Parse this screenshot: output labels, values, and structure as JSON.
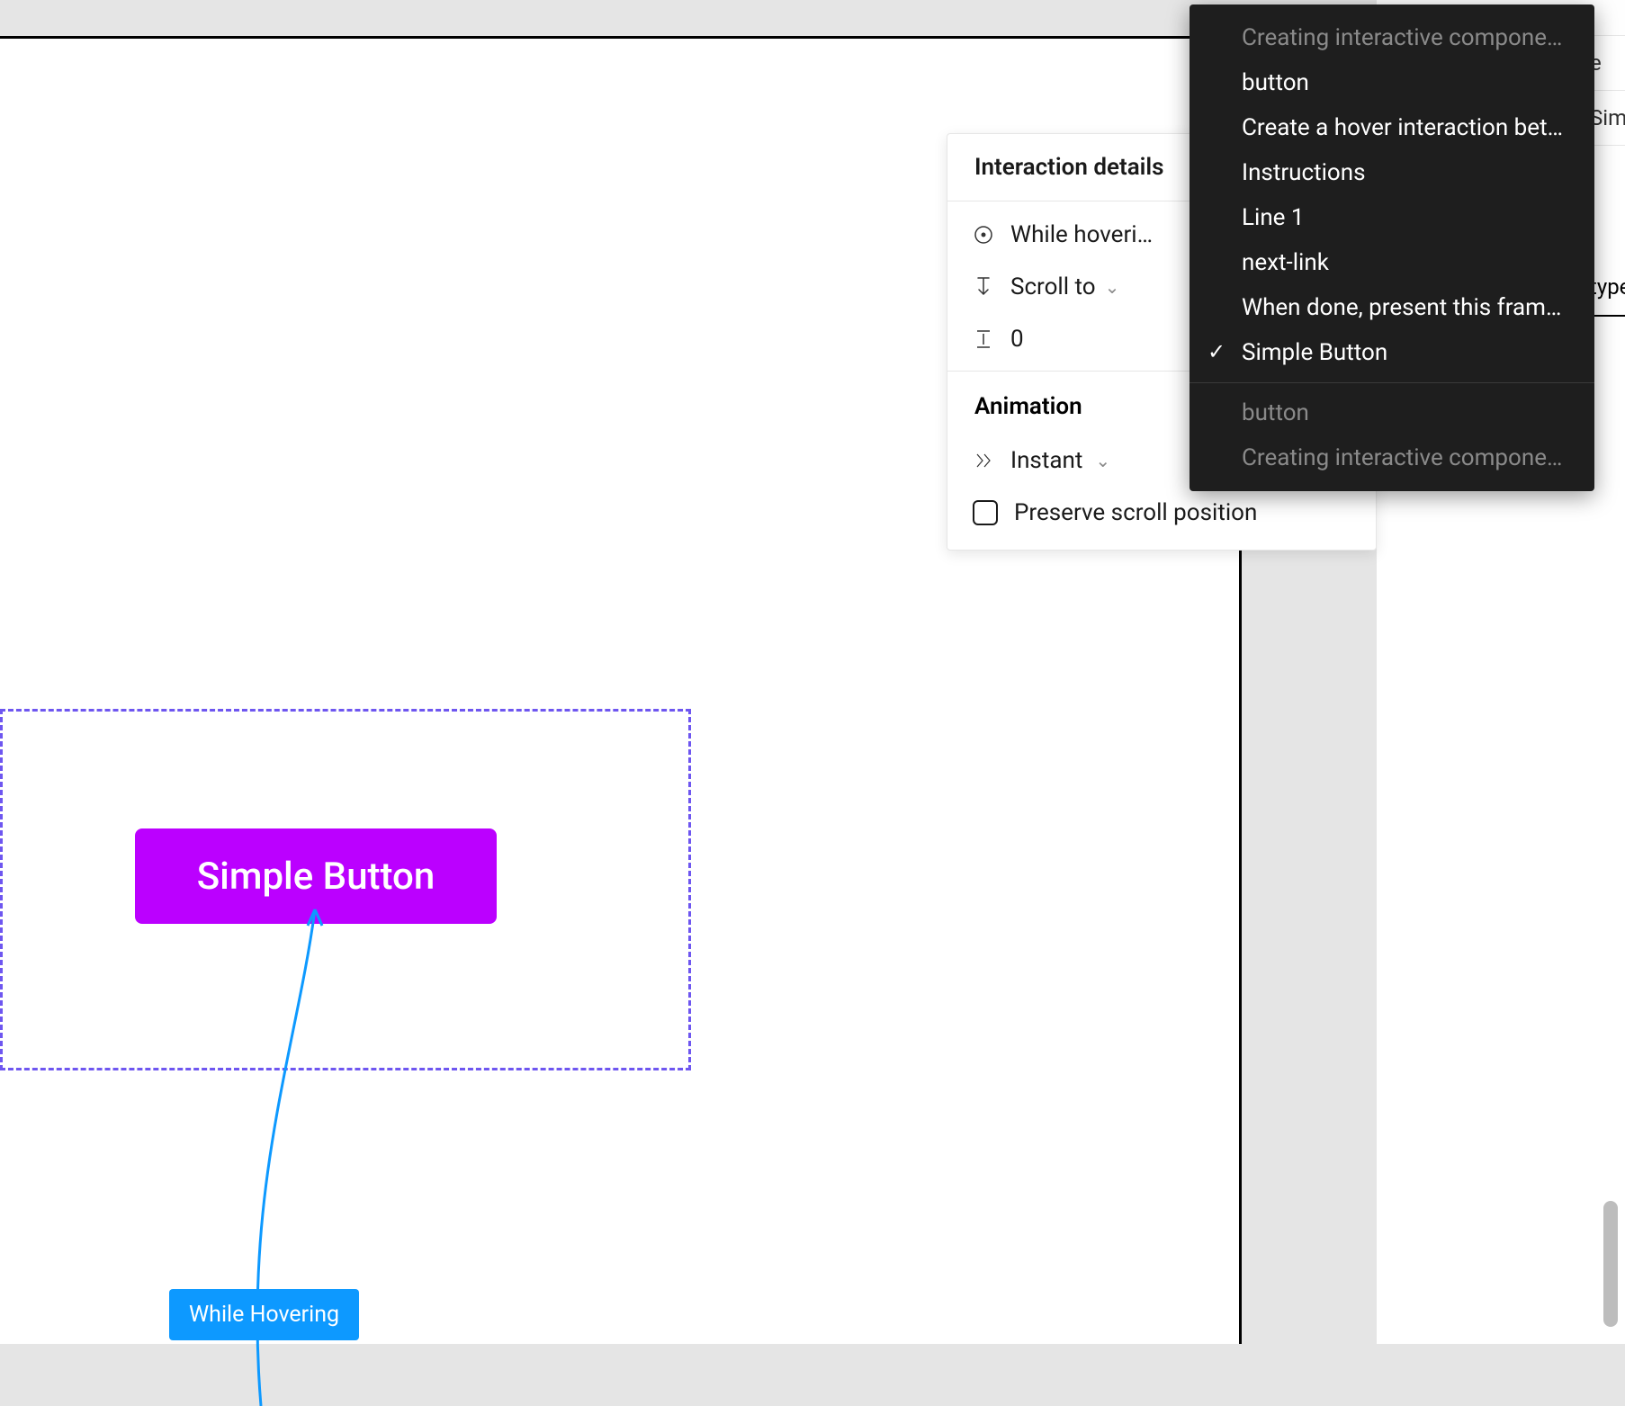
{
  "colors": {
    "button_bg": "#bb00ff",
    "selection_dash": "#6e56f0",
    "connector": "#0d99ff",
    "label_bg": "#0d99ff"
  },
  "canvas": {
    "button_label": "Simple Button",
    "hover_label": "While Hovering"
  },
  "panel": {
    "title": "Interaction details",
    "trigger_label": "While hoveri…",
    "action_label": "Scroll to",
    "offset_value": "0",
    "animation_header": "Animation",
    "animation_type": "Instant",
    "preserve_scroll_label": "Preserve scroll position"
  },
  "dropdown": {
    "items": [
      {
        "label": "Creating interactive components",
        "muted": true,
        "selected": false
      },
      {
        "label": "button",
        "muted": false,
        "selected": false
      },
      {
        "label": "Create a hover interaction bet…",
        "muted": false,
        "selected": false
      },
      {
        "label": "Instructions",
        "muted": false,
        "selected": false
      },
      {
        "label": "Line 1",
        "muted": false,
        "selected": false
      },
      {
        "label": "next-link",
        "muted": false,
        "selected": false
      },
      {
        "label": "When done, present this frame…",
        "muted": false,
        "selected": false
      },
      {
        "label": "Simple Button",
        "muted": false,
        "selected": true
      }
    ],
    "secondary_items": [
      {
        "label": "button",
        "muted": true
      },
      {
        "label": "Creating interactive components",
        "muted": true
      }
    ]
  },
  "right_sidebar": {
    "row1_fragment": "e",
    "row2_fragment": "Sim",
    "tab_fragment": "type"
  }
}
